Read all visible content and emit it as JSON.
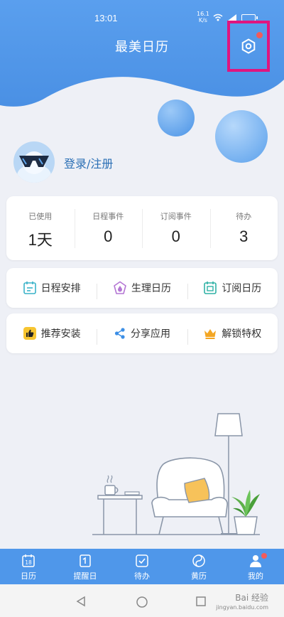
{
  "status": {
    "time": "13:01",
    "net_speed": "16.1",
    "net_unit": "K/s"
  },
  "header": {
    "title": "最美日历"
  },
  "profile": {
    "login_text": "登录/注册"
  },
  "stats": [
    {
      "label": "已使用",
      "value": "1天"
    },
    {
      "label": "日程事件",
      "value": "0"
    },
    {
      "label": "订阅事件",
      "value": "0"
    },
    {
      "label": "待办",
      "value": "3"
    }
  ],
  "features": {
    "schedule": "日程安排",
    "period": "生理日历",
    "subscribe": "订阅日历",
    "recommend": "推荐安装",
    "share": "分享应用",
    "unlock": "解锁特权"
  },
  "nav": {
    "calendar": "日历",
    "calendar_day": "18",
    "reminder": "提醒日",
    "todo": "待办",
    "almanac": "黄历",
    "me": "我的"
  },
  "watermark": {
    "brand": "Bai 经验",
    "url": "jingyan.baidu.com"
  },
  "colors": {
    "accent": "#4f97ea",
    "badge": "#f25b5b",
    "highlight_frame": "#e0157f"
  }
}
